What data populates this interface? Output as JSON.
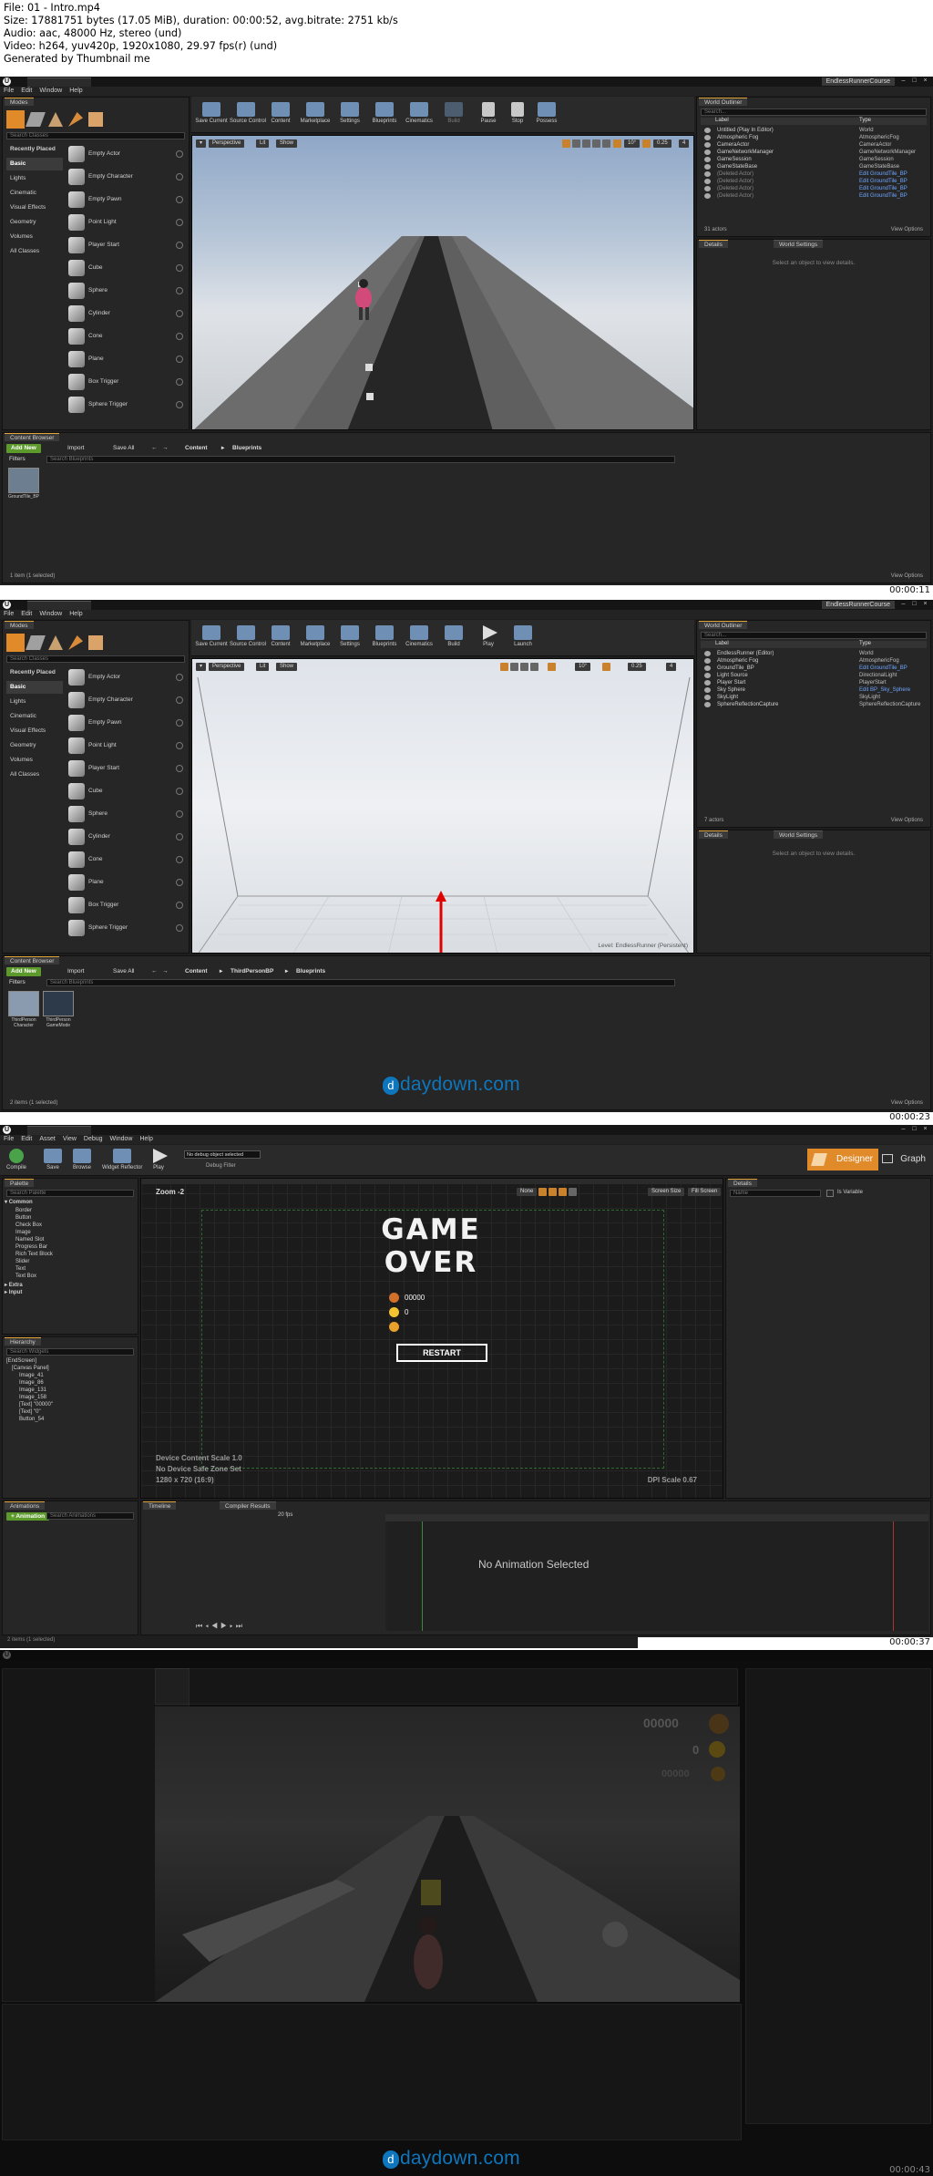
{
  "file_info": {
    "line1": "File: 01 - Intro.mp4",
    "line2": "Size: 17881751 bytes (17.05 MiB), duration: 00:00:52, avg.bitrate: 2751 kb/s",
    "line3": "Audio: aac, 48000 Hz, stereo (und)",
    "line4": "Video: h264, yuv420p, 1920x1080, 29.97 fps(r) (und)",
    "line5": "Generated by Thumbnail me"
  },
  "frames": {
    "f1": {
      "timestamp": "00:00:11",
      "project": "EndlessRunnerCourse",
      "menu": [
        "File",
        "Edit",
        "Window",
        "Help"
      ],
      "modes_tab": "Modes",
      "search_classes": "Search Classes",
      "categories": [
        "Recently Placed",
        "Basic",
        "Lights",
        "Cinematic",
        "Visual Effects",
        "Geometry",
        "Volumes",
        "All Classes"
      ],
      "place_items": [
        "Empty Actor",
        "Empty Character",
        "Empty Pawn",
        "Point Light",
        "Player Start",
        "Cube",
        "Sphere",
        "Cylinder",
        "Cone",
        "Plane",
        "Box Trigger",
        "Sphere Trigger"
      ],
      "toolbar": [
        "Save Current",
        "Source Control",
        "Content",
        "Marketplace",
        "Settings",
        "Blueprints",
        "Cinematics",
        "Build",
        "Pause",
        "Stop",
        "Possess"
      ],
      "vp_perspective": "Perspective",
      "vp_lit": "Lit",
      "vp_show": "Show",
      "vp_angle": "10°",
      "vp_scale": "0.25",
      "vp_cam": "4",
      "outliner_tab": "World Outliner",
      "search_placeholder": "Search...",
      "col_label": "Label",
      "col_type": "Type",
      "outliner_rows": [
        {
          "label": "Untitled (Play In Editor)",
          "type": "World"
        },
        {
          "label": "Atmospheric Fog",
          "type": "AtmosphericFog"
        },
        {
          "label": "CameraActor",
          "type": "CameraActor"
        },
        {
          "label": "GameNetworkManager",
          "type": "GameNetworkManager"
        },
        {
          "label": "GameSession",
          "type": "GameSession"
        },
        {
          "label": "GameStateBase",
          "type": "GameStateBase"
        },
        {
          "label": "(Deleted Actor)",
          "type": "Edit GroundTile_BP"
        },
        {
          "label": "(Deleted Actor)",
          "type": "Edit GroundTile_BP"
        },
        {
          "label": "(Deleted Actor)",
          "type": "Edit GroundTile_BP"
        },
        {
          "label": "(Deleted Actor)",
          "type": "Edit GroundTile_BP"
        }
      ],
      "actors_count": "31 actors",
      "view_options": "View Options",
      "details_tab": "Details",
      "world_settings_tab": "World Settings",
      "details_hint": "Select an object to view details.",
      "content_browser_tab": "Content Browser",
      "add_new": "Add New",
      "import": "Import",
      "save_all": "Save All",
      "crumbs": [
        "Content",
        "Blueprints"
      ],
      "filters": "Filters",
      "search_blueprints": "Search Blueprints",
      "asset": "GroundTile_BP",
      "items_status": "1 item (1 selected)"
    },
    "f2": {
      "timestamp": "00:00:23",
      "project": "EndlessRunnerCourse",
      "toolbar": [
        "Save Current",
        "Source Control",
        "Content",
        "Marketplace",
        "Settings",
        "Blueprints",
        "Cinematics",
        "Build",
        "Play",
        "Launch"
      ],
      "vp_angle": "10°",
      "vp_scale": "0.25",
      "vp_cam": "4",
      "level_label": "Level:  EndlessRunner (Persistent)",
      "outliner_rows": [
        {
          "label": "EndlessRunner (Editor)",
          "type": "World"
        },
        {
          "label": "Atmospheric Fog",
          "type": "AtmosphericFog"
        },
        {
          "label": "GroundTile_BP",
          "type": "Edit GroundTile_BP"
        },
        {
          "label": "Light Source",
          "type": "DirectionalLight"
        },
        {
          "label": "Player Start",
          "type": "PlayerStart"
        },
        {
          "label": "Sky Sphere",
          "type": "Edit BP_Sky_Sphere"
        },
        {
          "label": "SkyLight",
          "type": "SkyLight"
        },
        {
          "label": "SphereReflectionCapture",
          "type": "SphereReflectionCapture"
        }
      ],
      "actors_count": "7 actors",
      "crumbs": [
        "Content",
        "ThirdPersonBP",
        "Blueprints"
      ],
      "assets": [
        "ThirdPerson Character",
        "ThirdPerson GameMode"
      ],
      "items_status": "2 items (1 selected)",
      "watermark": "daydown.com"
    },
    "f3": {
      "timestamp": "00:00:37",
      "menu": [
        "File",
        "Edit",
        "Asset",
        "View",
        "Debug",
        "Window",
        "Help"
      ],
      "toolbar": [
        "Compile",
        "Save",
        "Browse",
        "Widget Reflector",
        "Play"
      ],
      "debug_select": "No debug object selected",
      "debug_filter": "Debug Filter",
      "designer": "Designer",
      "graph": "Graph",
      "palette_tab": "Palette",
      "search_palette": "Search Palette",
      "palette_common": "Common",
      "palette_items": [
        "Border",
        "Button",
        "Check Box",
        "Image",
        "Named Slot",
        "Progress Bar",
        "Rich Text Block",
        "Slider",
        "Text",
        "Text Box"
      ],
      "palette_extra": [
        "Extra",
        "Input"
      ],
      "hierarchy_tab": "Hierarchy",
      "search_widgets": "Search Widgets",
      "hierarchy": [
        "[EndScreen]",
        "[Canvas Panel]",
        "Image_41",
        "Image_86",
        "Image_131",
        "Image_158",
        "[Text] \"00000\"",
        "[Text] \"0\"",
        "Button_54"
      ],
      "zoom": "Zoom -2",
      "none_btn": "None",
      "screen_size": "Screen Size",
      "fill_screen": "Fill Screen",
      "details_tab": "Details",
      "is_variable": "Is Variable",
      "name_ph": "Name",
      "game_over_1": "GAME",
      "game_over_2": "OVER",
      "score": "00000",
      "coins": "0",
      "restart": "RESTART",
      "scale_text": "Device Content Scale 1.0",
      "safezone_text": "No Device Safe Zone Set",
      "res_text": "1280 x 720 (16:9)",
      "dpi_text": "DPI Scale 0.67",
      "animations_tab": "Animations",
      "add_animation": "+ Animation",
      "search_animations": "Search Animations",
      "timeline_tab": "Timeline",
      "compiler_tab": "Compiler Results",
      "no_anim": "No Animation Selected",
      "fps": "20 fps",
      "items_status": "2 items (1 selected)"
    },
    "f4": {
      "timestamp": "00:00:43",
      "hud_score": "00000",
      "hud_coins": "0",
      "hud_best": "00000",
      "watermark": "daydown.com"
    }
  },
  "colors": {
    "ue_bg": "#1e1e1e",
    "accent_orange": "#e2a33b",
    "green": "#5c9a2c",
    "watermark_blue": "#0e76bc"
  }
}
